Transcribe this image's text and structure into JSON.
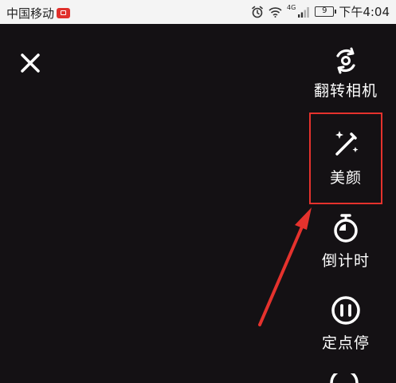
{
  "status_bar": {
    "carrier": "中国移动",
    "network": "4G",
    "battery": "9",
    "time": "下午4:04"
  },
  "tools": {
    "flip": {
      "label": "翻转相机",
      "icon": "flip-camera-icon"
    },
    "beauty": {
      "label": "美颜",
      "icon": "magic-wand-icon"
    },
    "timer": {
      "label": "倒计时",
      "icon": "timer-icon"
    },
    "pause": {
      "label": "定点停",
      "icon": "pause-icon"
    }
  },
  "annotation": {
    "color": "#e5322d"
  }
}
